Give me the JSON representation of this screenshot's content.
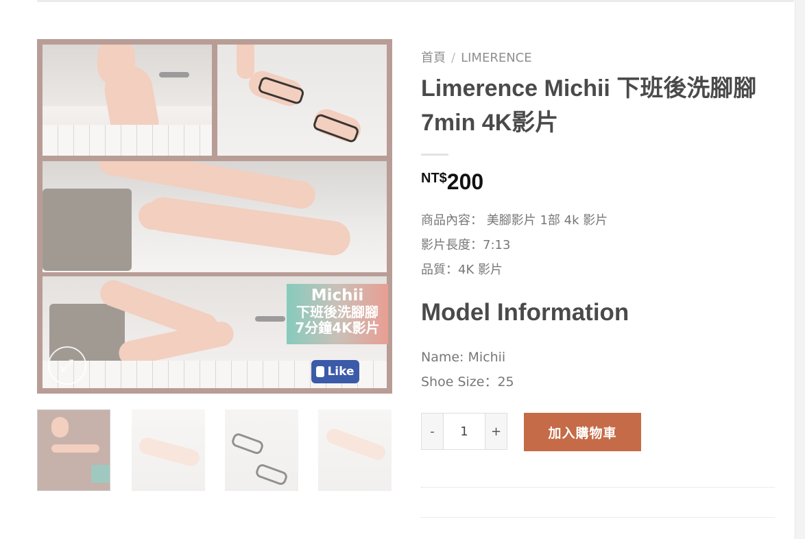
{
  "breadcrumb": {
    "home": "首頁",
    "separator": "/",
    "category": "LIMERENCE"
  },
  "product": {
    "title": "Limerence Michii 下班後洗腳腳 7min 4K影片",
    "currency": "NT$",
    "price": "200",
    "description": [
      "商品內容： 美腳影片 1部 4k 影片",
      "影片長度：7:13",
      "品質：4K 影片"
    ]
  },
  "model": {
    "heading": "Model Information",
    "name": "Name: Michii",
    "shoe_size": "Shoe Size：25"
  },
  "gallery": {
    "caption_line1": "Michii",
    "caption_line2": "下班後洗腳腳",
    "caption_line3": "7分鐘4K影片",
    "like_label": "Like",
    "thumbnail_count": 4,
    "active_thumbnail": 1
  },
  "cart": {
    "qty_minus": "-",
    "qty_value": "1",
    "qty_plus": "+",
    "add_to_cart": "加入購物車"
  },
  "colors": {
    "accent": "#c56b47",
    "title": "#4a4a4a",
    "price": "#111111"
  },
  "icons": {
    "zoom": "expand-icon"
  }
}
